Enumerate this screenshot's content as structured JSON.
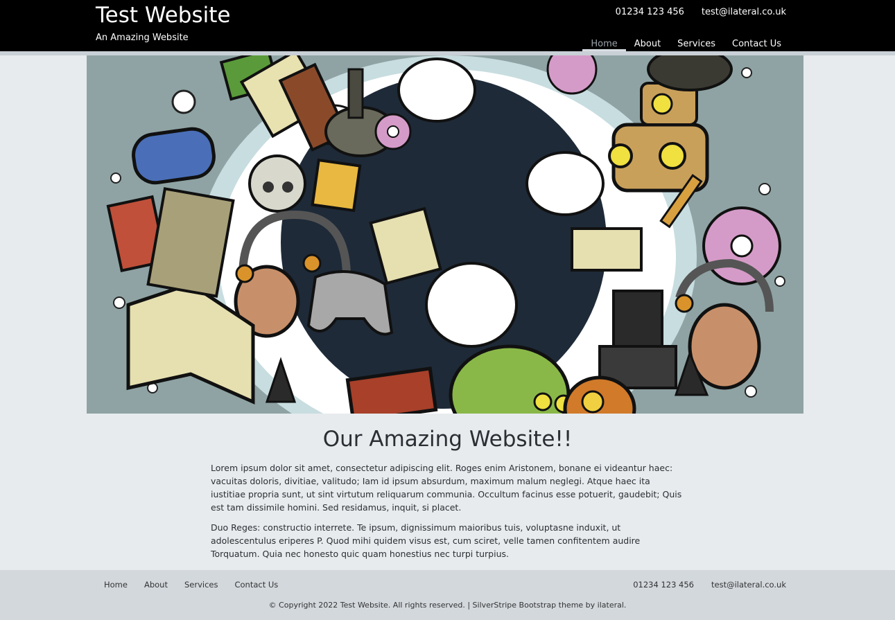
{
  "header": {
    "title": "Test Website",
    "tagline": "An Amazing Website",
    "phone": "01234 123 456",
    "email": "test@ilateral.co.uk",
    "nav": [
      {
        "label": "Home",
        "active": true
      },
      {
        "label": "About",
        "active": false
      },
      {
        "label": "Services",
        "active": false
      },
      {
        "label": "Contact Us",
        "active": false
      }
    ]
  },
  "main": {
    "heading": "Our Amazing Website!!",
    "paragraphs": [
      "Lorem ipsum dolor sit amet, consectetur adipiscing elit. Roges enim Aristonem, bonane ei videantur haec: vacuitas doloris, divitiae, valitudo; Iam id ipsum absurdum, maximum malum neglegi. Atque haec ita iustitiae propria sunt, ut sint virtutum reliquarum communia. Occultum facinus esse potuerit, gaudebit; Quis est tam dissimile homini. Sed residamus, inquit, si placet.",
      "Duo Reges: constructio interrete. Te ipsum, dignissimum maioribus tuis, voluptasne induxit, ut adolescentulus eriperes P. Quod mihi quidem visus est, cum sciret, velle tamen confitentem audire Torquatum. Quia nec honesto quic quam honestius nec turpi turpius."
    ]
  },
  "footer": {
    "nav": [
      "Home",
      "About",
      "Services",
      "Contact Us"
    ],
    "phone": "01234 123 456",
    "email": "test@ilateral.co.uk",
    "copyright": "© Copyright 2022 Test Website. All rights reserved. | SilverStripe Bootstrap theme by ilateral."
  },
  "colors": {
    "header_bg": "#000000",
    "page_bg": "#e7ebee",
    "footer_bg": "#d3d8dd",
    "hero_bg": "#8fa3a4"
  }
}
